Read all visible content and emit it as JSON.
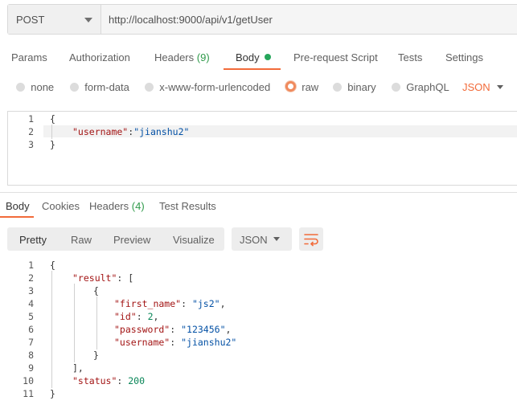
{
  "request": {
    "method": "POST",
    "url": "http://localhost:9000/api/v1/getUser"
  },
  "request_tabs": {
    "params": "Params",
    "authorization": "Authorization",
    "headers": "Headers",
    "headers_count": "(9)",
    "body": "Body",
    "prerequest": "Pre-request Script",
    "tests": "Tests",
    "settings": "Settings"
  },
  "body_types": {
    "none": "none",
    "form_data": "form-data",
    "urlencoded": "x-www-form-urlencoded",
    "raw": "raw",
    "binary": "binary",
    "graphql": "GraphQL",
    "format": "JSON"
  },
  "request_body": {
    "line_numbers": [
      "1",
      "2",
      "3"
    ],
    "open": "{",
    "key": "\"username\"",
    "colon": ":",
    "value": "\"jianshu2\"",
    "close": "}"
  },
  "response_tabs": {
    "body": "Body",
    "cookies": "Cookies",
    "headers": "Headers",
    "headers_count": "(4)",
    "test_results": "Test Results"
  },
  "view_modes": {
    "pretty": "Pretty",
    "raw": "Raw",
    "preview": "Preview",
    "visualize": "Visualize",
    "format": "JSON"
  },
  "response_body": {
    "line_numbers": [
      "1",
      "2",
      "3",
      "4",
      "5",
      "6",
      "7",
      "8",
      "9",
      "10",
      "11"
    ],
    "l1": "{",
    "l2_key": "\"result\"",
    "l2_rest": ": [",
    "l3": "{",
    "l4_key": "\"first_name\"",
    "l4_val": "\"js2\"",
    "l5_key": "\"id\"",
    "l5_val": "2",
    "l6_key": "\"password\"",
    "l6_val": "\"123456\"",
    "l7_key": "\"username\"",
    "l7_val": "\"jianshu2\"",
    "l8": "}",
    "l9": "],",
    "l10_key": "\"status\"",
    "l10_val": "200",
    "l11": "}"
  },
  "colors": {
    "accent": "#f26b3a",
    "count_green": "#2f9a4a",
    "string_blue": "#0451a5",
    "key_red": "#a31515"
  }
}
